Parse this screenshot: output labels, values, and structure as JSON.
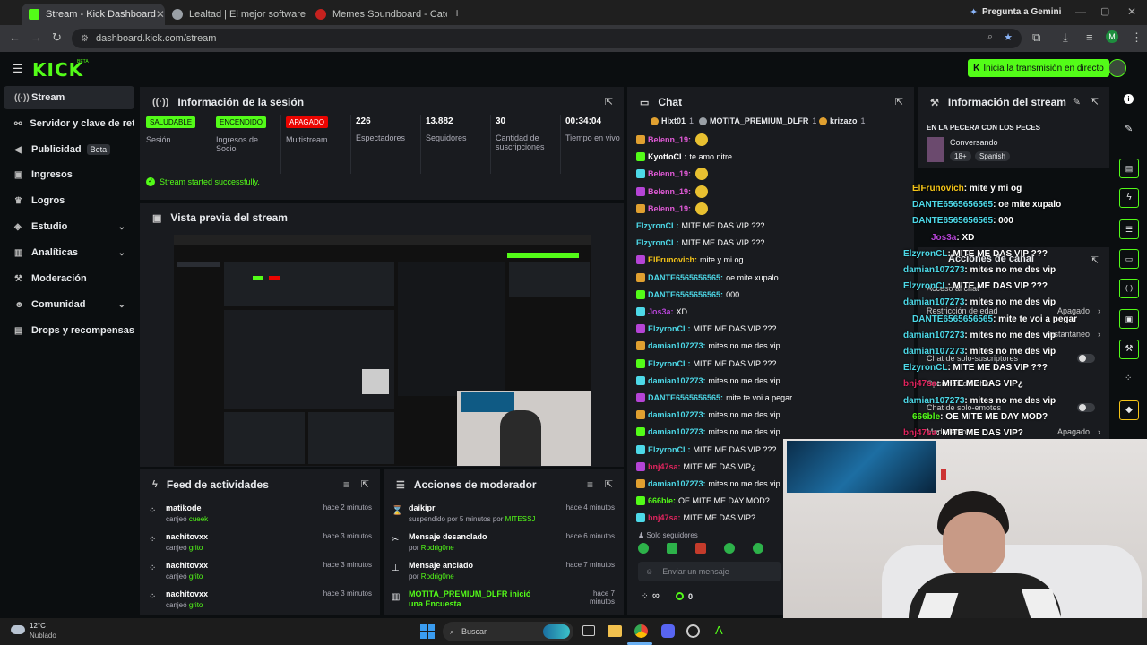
{
  "browser": {
    "tabs": [
      {
        "title": "Stream - Kick Dashboard",
        "active": true,
        "color": "#53fc18"
      },
      {
        "title": "Lealtad | El mejor software para",
        "active": false,
        "color": "#9aa0a6"
      },
      {
        "title": "Memes Soundboard - Categor",
        "active": false,
        "color": "#c5221f"
      }
    ],
    "new_tab": "+",
    "gemini": "Pregunta a Gemini",
    "url": "dashboard.kick.com/stream",
    "profile_initial": "M"
  },
  "kick": {
    "logo": "KICK",
    "beta": "BETA",
    "go_live": "Inicia la transmisión en directo"
  },
  "sidebar": {
    "items": [
      {
        "label": "Stream",
        "icon": "broadcast-icon",
        "glyph": "((·))",
        "active": true
      },
      {
        "label": "Servidor y clave de retran",
        "icon": "link-icon",
        "glyph": "⚯"
      },
      {
        "label": "Publicidad",
        "icon": "megaphone-icon",
        "glyph": "◀",
        "badge": "Beta"
      },
      {
        "label": "Ingresos",
        "icon": "money-icon",
        "glyph": "▣"
      },
      {
        "label": "Logros",
        "icon": "trophy-icon",
        "glyph": "♛"
      },
      {
        "label": "Estudio",
        "icon": "layers-icon",
        "glyph": "◈",
        "chevron": true
      },
      {
        "label": "Analíticas",
        "icon": "chart-icon",
        "glyph": "▥",
        "chevron": true
      },
      {
        "label": "Moderación",
        "icon": "hammer-icon",
        "glyph": "⚒"
      },
      {
        "label": "Comunidad",
        "icon": "people-icon",
        "glyph": "☻",
        "chevron": true
      },
      {
        "label": "Drops y recompensas",
        "icon": "gift-icon",
        "glyph": "▤"
      }
    ]
  },
  "session": {
    "title": "Información de la sesión",
    "stats": [
      {
        "pill": "SALUDABLE",
        "label": "Sesión",
        "color": "#53fc18"
      },
      {
        "pill": "ENCENDIDO",
        "label": "Ingresos de Socio",
        "color": "#53fc18"
      },
      {
        "pill": "APAGADO",
        "label": "Multistream",
        "color": "#eb0400"
      },
      {
        "value": "226",
        "label": "Espectadores"
      },
      {
        "value": "13.882",
        "label": "Seguidores"
      },
      {
        "value": "30",
        "label": "Cantidad de suscripciones"
      },
      {
        "value": "00:34:04",
        "label": "Tiempo en vivo"
      }
    ],
    "success": "Stream started successfully."
  },
  "preview": {
    "title": "Vista previa del stream"
  },
  "feed": {
    "title": "Feed de actividades",
    "rows": [
      {
        "name": "matikode",
        "action": "canjeó",
        "item": "cueek",
        "time": "hace 2 minutos"
      },
      {
        "name": "nachitovxx",
        "action": "canjeó",
        "item": "grito",
        "time": "hace 3 minutos"
      },
      {
        "name": "nachitovxx",
        "action": "canjeó",
        "item": "grito",
        "time": "hace 3 minutos"
      },
      {
        "name": "nachitovxx",
        "action": "canjeó",
        "item": "grito",
        "time": "hace 3 minutos"
      }
    ]
  },
  "modactions": {
    "title": "Acciones de moderador",
    "rows": [
      {
        "name": "daikipr",
        "sub": "suspendido por 5 minutos por",
        "by": "MITESSJ",
        "time": "hace 4 minutos",
        "icon": "hourglass-icon",
        "glyph": "⌛"
      },
      {
        "name": "Mensaje desanclado",
        "sub": "por",
        "by": "Rodrig0ne",
        "time": "hace 6 minutos",
        "icon": "unpin-icon",
        "glyph": "✂"
      },
      {
        "name": "Mensaje anclado",
        "sub": "por",
        "by": "Rodrig0ne",
        "time": "hace 7 minutos",
        "icon": "pin-icon",
        "glyph": "⊥"
      },
      {
        "name": "MOTITA_PREMIUM_DLFR inició una Encuesta",
        "sub": "",
        "by": "",
        "time": "hace 7 minutos",
        "icon": "poll-icon",
        "glyph": "▥"
      }
    ]
  },
  "chat": {
    "title": "Chat",
    "top_gifters": [
      {
        "name": "Hixt01",
        "count": "1"
      },
      {
        "name": "MOTITA_PREMIUM_DLFR",
        "count": "1"
      },
      {
        "name": "krizazo",
        "count": "1"
      }
    ],
    "messages": [
      {
        "user": "Belenn_19:",
        "text": "",
        "color": "#e05ad6",
        "emoji": true
      },
      {
        "user": "KyottoCL:",
        "text": "te amo nitre",
        "color": "#ffffff"
      },
      {
        "user": "Belenn_19:",
        "text": "",
        "color": "#e05ad6",
        "emoji": true
      },
      {
        "user": "Belenn_19:",
        "text": "",
        "color": "#e05ad6",
        "emoji": true
      },
      {
        "user": "Belenn_19:",
        "text": "",
        "color": "#e05ad6",
        "emoji": true
      },
      {
        "user": "ElzyronCL:",
        "text": "MITE ME DAS VIP ???",
        "color": "#4dd9e8"
      },
      {
        "user": "ElzyronCL:",
        "text": "MITE ME DAS VIP ???",
        "color": "#4dd9e8"
      },
      {
        "user": "ElFrunovich:",
        "text": "mite y mi og",
        "color": "#f5c518"
      },
      {
        "user": "DANTE6565656565:",
        "text": "oe mite xupalo",
        "color": "#4dd9e8"
      },
      {
        "user": "DANTE6565656565:",
        "text": "000",
        "color": "#4dd9e8"
      },
      {
        "user": "Jos3a:",
        "text": "XD",
        "color": "#b544d6"
      },
      {
        "user": "ElzyronCL:",
        "text": "MITE ME DAS VIP ???",
        "color": "#4dd9e8"
      },
      {
        "user": "damian107273:",
        "text": "mites no me des vip",
        "color": "#4dd9e8"
      },
      {
        "user": "ElzyronCL:",
        "text": "MITE ME DAS VIP ???",
        "color": "#4dd9e8"
      },
      {
        "user": "damian107273:",
        "text": "mites no me des vip",
        "color": "#4dd9e8"
      },
      {
        "user": "DANTE6565656565:",
        "text": "mite te voi a pegar",
        "color": "#4dd9e8"
      },
      {
        "user": "damian107273:",
        "text": "mites no me des vip",
        "color": "#4dd9e8"
      },
      {
        "user": "damian107273:",
        "text": "mites no me des vip",
        "color": "#4dd9e8"
      },
      {
        "user": "ElzyronCL:",
        "text": "MITE ME DAS VIP ???",
        "color": "#4dd9e8"
      },
      {
        "user": "bnj47sa:",
        "text": "MITE ME DAS VIP¿",
        "color": "#e0245e"
      },
      {
        "user": "damian107273:",
        "text": "mites no me des vip",
        "color": "#4dd9e8"
      },
      {
        "user": "666ble:",
        "text": "OE MITE ME DAY MOD?",
        "color": "#53fc18"
      },
      {
        "user": "bnj47sa:",
        "text": "MITE ME DAS VIP?",
        "color": "#e0245e"
      }
    ],
    "followers_only": "Solo seguidores",
    "input_placeholder": "Enviar un mensaje",
    "infinity": "∞",
    "points": "0"
  },
  "streaminfo": {
    "title": "Información del stream",
    "stream_title": "EN LA PECERA CON LOS PECES",
    "category": "Conversando",
    "tags": [
      "18+",
      "Spanish"
    ]
  },
  "overlay_chat": [
    {
      "user": "ElFrunovich",
      "text": ": mite y mi og",
      "color": "#f5c518"
    },
    {
      "user": "DANTE6565656565",
      "text": ": oe mite xupalo",
      "color": "#4dd9e8"
    },
    {
      "user": "DANTE6565656565",
      "text": ": 000",
      "color": "#4dd9e8"
    },
    {
      "user": "Jos3a",
      "text": ": XD",
      "color": "#b544d6"
    },
    {
      "user": "ElzyronCL",
      "text": ": MITE ME DAS VIP ???",
      "color": "#4dd9e8"
    },
    {
      "user": "damian107273",
      "text": ": mites no me des vip",
      "color": "#4dd9e8"
    },
    {
      "user": "ElzyronCL",
      "text": ": MITE ME DAS VIP ???",
      "color": "#4dd9e8"
    },
    {
      "user": "damian107273",
      "text": ": mites no me des vip",
      "color": "#4dd9e8"
    },
    {
      "user": "DANTE6565656565",
      "text": ": mite te voi a pegar",
      "color": "#4dd9e8"
    },
    {
      "user": "damian107273",
      "text": ": mites no me des vip",
      "color": "#4dd9e8"
    },
    {
      "user": "damian107273",
      "text": ": mites no me des vip",
      "color": "#4dd9e8"
    },
    {
      "user": "ElzyronCL",
      "text": ": MITE ME DAS VIP ???",
      "color": "#4dd9e8"
    },
    {
      "user": "bnj47sa",
      "text": ": MITE ME DAS VIP¿",
      "color": "#e0245e"
    },
    {
      "user": "damian107273",
      "text": ": mites no me des vip",
      "color": "#4dd9e8"
    },
    {
      "user": "666ble",
      "text": ": OE MITE ME DAY MOD?",
      "color": "#53fc18"
    },
    {
      "user": "bnj47sa",
      "text": ": MITE ME DAS VIP?",
      "color": "#e0245e"
    }
  ],
  "channel_actions": {
    "title": "Acciones de canal",
    "items": [
      {
        "label": "Acceso al chat"
      },
      {
        "label": "Restricción de edad",
        "value": "Apagado"
      },
      {
        "label": "",
        "value": "Instantáneo"
      },
      {
        "label": "Chat de solo-suscriptores",
        "toggle": true
      },
      {
        "label": "Opciones del chat"
      },
      {
        "label": "Chat de solo-emotes",
        "toggle": true
      },
      {
        "label": "Modo lento",
        "value": "Apagado"
      }
    ]
  },
  "taskbar": {
    "temp": "12°C",
    "weather": "Nublado",
    "search": "Buscar"
  }
}
